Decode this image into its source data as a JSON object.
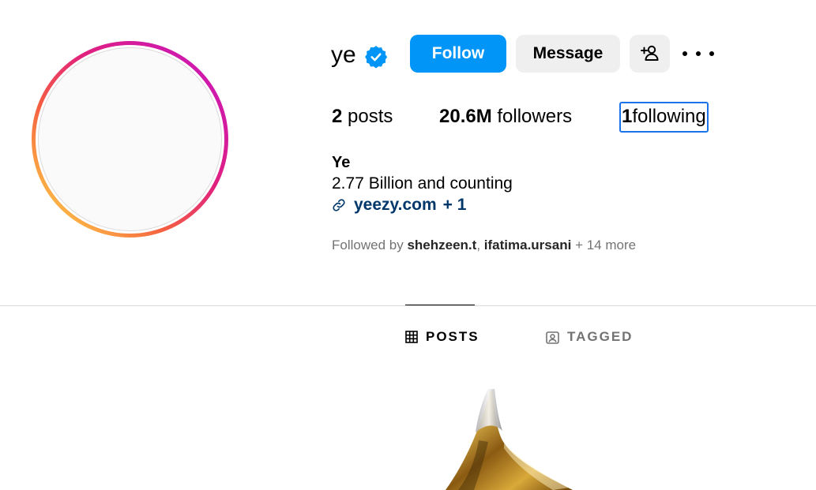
{
  "profile": {
    "username": "ye",
    "verified_icon": "verified-badge-icon",
    "full_name": "Ye",
    "bio": "2.77 Billion and counting",
    "link_text": "yeezy.com",
    "link_extra": "+ 1"
  },
  "actions": {
    "follow_label": "Follow",
    "message_label": "Message",
    "add_user_icon": "add-user-icon",
    "more_icon": "more-options-icon"
  },
  "stats": {
    "posts_count": "2",
    "posts_label": "posts",
    "followers_count": "20.6M",
    "followers_label": "followers",
    "following_count": "1",
    "following_label": "following"
  },
  "followed_by": {
    "prefix": "Followed by",
    "user1": "shehzeen.t",
    "separator": ",",
    "user2": "ifatima.ursani",
    "suffix": "+ 14 more"
  },
  "tabs": [
    {
      "label": "POSTS",
      "icon": "grid-icon",
      "active": true
    },
    {
      "label": "TAGGED",
      "icon": "tagged-icon",
      "active": false
    }
  ],
  "colors": {
    "follow_button": "#0095f6",
    "secondary_button": "#efefef",
    "link": "#00376b",
    "muted_text": "#737373",
    "focus_outline": "#1a73e8"
  }
}
